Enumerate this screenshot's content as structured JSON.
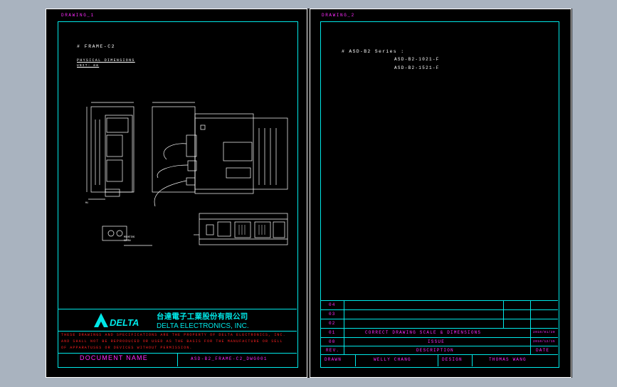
{
  "sheet1": {
    "title": "DRAWING_1",
    "frame_name": "# FRAME-C2",
    "phys_dim": "PHYSICAL DIMENSIONS",
    "unit": "UNIT: mm",
    "company_cn": "台達電子工業股份有限公司",
    "company_en": "DELTA ELECTRONICS, INC.",
    "logo_text": "DELTA",
    "notice_line1": "THESE DRAWINGS AND SPECIFICATIONS ARE THE PROPERTY OF DELTA ELECTRONICS, INC.",
    "notice_line2": "AND SHALL NOT BE REPRODUCED OR USED AS THE BASIS FOR THE MANUFACTURE OR SELL",
    "notice_line3": "OF APPARATUSES OR DEVICES WITHOUT PERMISSION.",
    "doc_name_label": "DOCUMENT NAME",
    "doc_name_value": "ASD-B2_FRAME-C2_DWG001"
  },
  "sheet2": {
    "title": "DRAWING_2",
    "series": "# ASD-B2 Series :",
    "models": [
      "ASD-B2-1021-F",
      "ASD-B2-1521-F"
    ],
    "revisions": [
      {
        "rev": "04",
        "desc": "",
        "date": ""
      },
      {
        "rev": "03",
        "desc": "",
        "date": ""
      },
      {
        "rev": "02",
        "desc": "",
        "date": ""
      },
      {
        "rev": "01",
        "desc": "CORRECT DRAWING SCALE & DIMENSIONS",
        "date": "2010/01/20"
      },
      {
        "rev": "00",
        "desc": "ISSUE",
        "date": "2010/12/15"
      }
    ],
    "rev_header": "REV.",
    "desc_header": "DESCRIPTION",
    "date_header": "DATE",
    "drawn_label": "DRAWN",
    "drawn_by": "WELLY CHANG",
    "design_label": "DESIGN",
    "design_by": "THOMAS WANG"
  },
  "colors": {
    "background": "#a9b3bf",
    "canvas": "#000000",
    "frame": "#ffffff",
    "border": "#00e8e8",
    "text_label": "#ff2bff",
    "notice": "#ff2020",
    "company": "#00e8e8"
  }
}
